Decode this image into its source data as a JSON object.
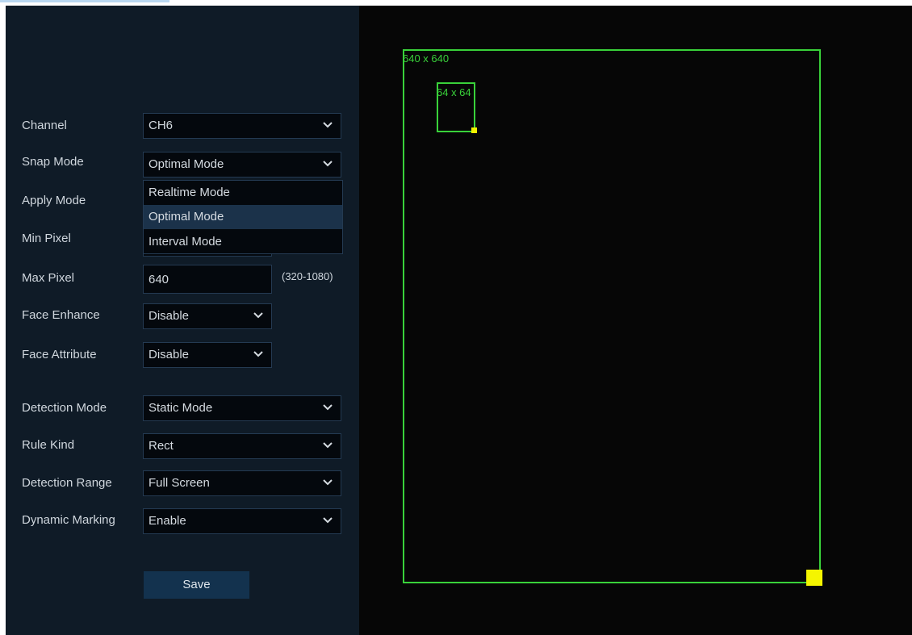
{
  "labels": {
    "channel": "Channel",
    "snap_mode": "Snap Mode",
    "apply_mode": "Apply Mode",
    "min_pixel": "Min Pixel",
    "max_pixel": "Max Pixel",
    "face_enhance": "Face Enhance",
    "face_attribute": "Face Attribute",
    "detection_mode": "Detection Mode",
    "rule_kind": "Rule Kind",
    "detection_range": "Detection Range",
    "dynamic_marking": "Dynamic Marking"
  },
  "values": {
    "channel": "CH6",
    "snap_mode": "Optimal Mode",
    "max_pixel": "640",
    "max_pixel_range": "(320-1080)",
    "face_enhance": "Disable",
    "face_attribute": "Disable",
    "detection_mode": "Static Mode",
    "rule_kind": "Rect",
    "detection_range": "Full Screen",
    "dynamic_marking": "Enable"
  },
  "snap_mode_dropdown": {
    "options": [
      "Realtime Mode",
      "Optimal Mode",
      "Interval Mode"
    ],
    "highlighted": "Optimal Mode"
  },
  "save_label": "Save",
  "overlay": {
    "outer_label": "640 x 640",
    "inner_label": "64 x 64",
    "color": "#39d13a",
    "handle_color": "#f5f500"
  },
  "colors": {
    "panel_bg": "#0f1b27",
    "field_bg": "#04080d",
    "field_border": "#243a52",
    "highlight": "#1b324a",
    "save_bg": "#13324e"
  },
  "icons": {
    "dropdown_arrow": "chevron-down-icon"
  }
}
